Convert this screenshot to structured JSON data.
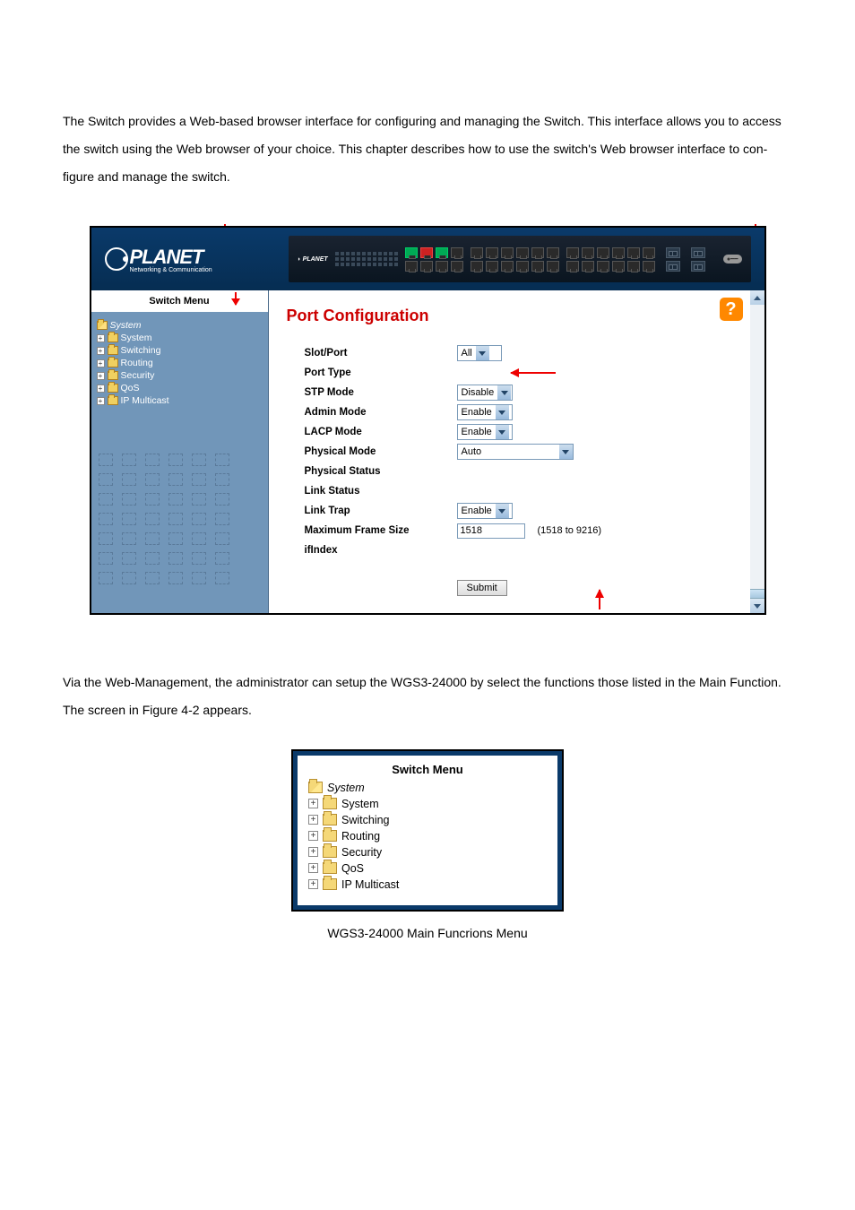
{
  "intro_text": "The Switch provides a Web-based browser interface for configuring and managing the Switch. This interface allows you to access the switch using the Web browser of your choice. This chapter describes how to use the switch's Web browser interface to con-figure and manage the switch.",
  "screenshot": {
    "logo_text": "PLANET",
    "logo_tagline": "Networking & Communication",
    "switch_menu_title": "Switch Menu",
    "menu": {
      "root": "System",
      "items": [
        "System",
        "Switching",
        "Routing",
        "Security",
        "QoS",
        "IP Multicast"
      ]
    },
    "content": {
      "title": "Port Configuration",
      "rows": [
        {
          "label": "Slot/Port",
          "control": "dropdown",
          "value": "All"
        },
        {
          "label": "Port Type",
          "control": "arrow"
        },
        {
          "label": "STP Mode",
          "control": "dropdown",
          "value": "Disable"
        },
        {
          "label": "Admin Mode",
          "control": "dropdown",
          "value": "Enable"
        },
        {
          "label": "LACP Mode",
          "control": "dropdown",
          "value": "Enable"
        },
        {
          "label": "Physical Mode",
          "control": "dropdown_wide",
          "value": "Auto"
        },
        {
          "label": "Physical Status",
          "control": "none"
        },
        {
          "label": "Link Status",
          "control": "none"
        },
        {
          "label": "Link Trap",
          "control": "dropdown",
          "value": "Enable"
        },
        {
          "label": "Maximum Frame Size",
          "control": "input",
          "value": "1518",
          "range": "(1518 to 9216)"
        },
        {
          "label": "ifIndex",
          "control": "none"
        }
      ],
      "submit": "Submit"
    }
  },
  "mid_text": "Via the Web-Management, the administrator can setup the WGS3-24000 by select the functions those listed in the Main Function. The screen in Figure 4-2 appears.",
  "screenshot2": {
    "title": "Switch Menu",
    "root": "System",
    "items": [
      "System",
      "Switching",
      "Routing",
      "Security",
      "QoS",
      "IP Multicast"
    ]
  },
  "caption": "WGS3-24000 Main Funcrions Menu"
}
